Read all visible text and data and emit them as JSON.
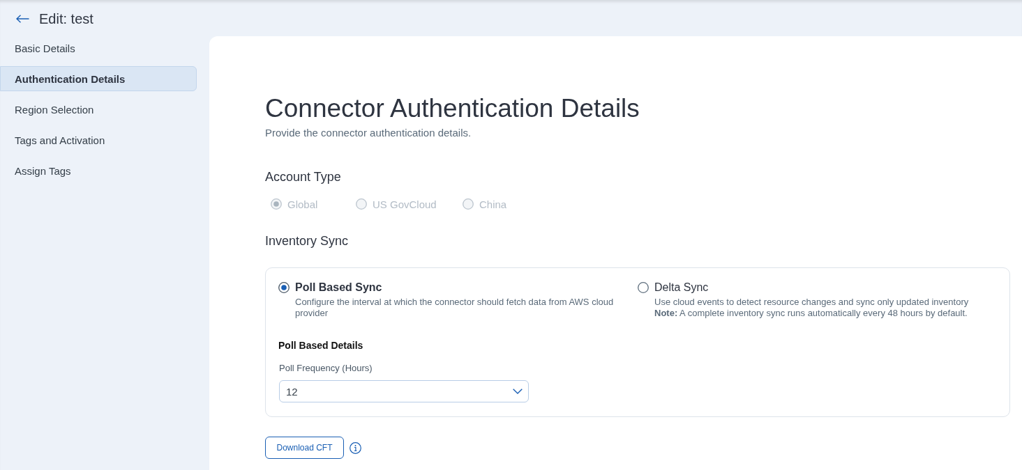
{
  "header": {
    "title": "Edit: test"
  },
  "sidebar": {
    "items": [
      {
        "label": "Basic Details",
        "selected": false
      },
      {
        "label": "Authentication Details",
        "selected": true
      },
      {
        "label": "Region Selection",
        "selected": false
      },
      {
        "label": "Tags and Activation",
        "selected": false
      },
      {
        "label": "Assign Tags",
        "selected": false
      }
    ]
  },
  "main": {
    "title": "Connector Authentication Details",
    "subtitle": "Provide the connector authentication details."
  },
  "account_type": {
    "label": "Account Type",
    "options": [
      {
        "label": "Global",
        "selected": true,
        "disabled": true
      },
      {
        "label": "US GovCloud",
        "selected": false,
        "disabled": true
      },
      {
        "label": "China",
        "selected": false,
        "disabled": true
      }
    ]
  },
  "inventory_sync": {
    "label": "Inventory Sync",
    "options": [
      {
        "label": "Poll Based Sync",
        "selected": true,
        "description": "Configure the interval at which the connector should fetch data from AWS cloud provider"
      },
      {
        "label": "Delta Sync",
        "selected": false,
        "description": "Use cloud events to detect resource changes and sync only updated inventory",
        "note": "**Note:** A complete inventory sync runs automatically every 48 hours by default."
      }
    ],
    "details": {
      "title": "Poll Based Details",
      "field_label": "Poll Frequency (Hours)",
      "value": "12"
    }
  },
  "download_button": {
    "label": "Download CFT"
  }
}
